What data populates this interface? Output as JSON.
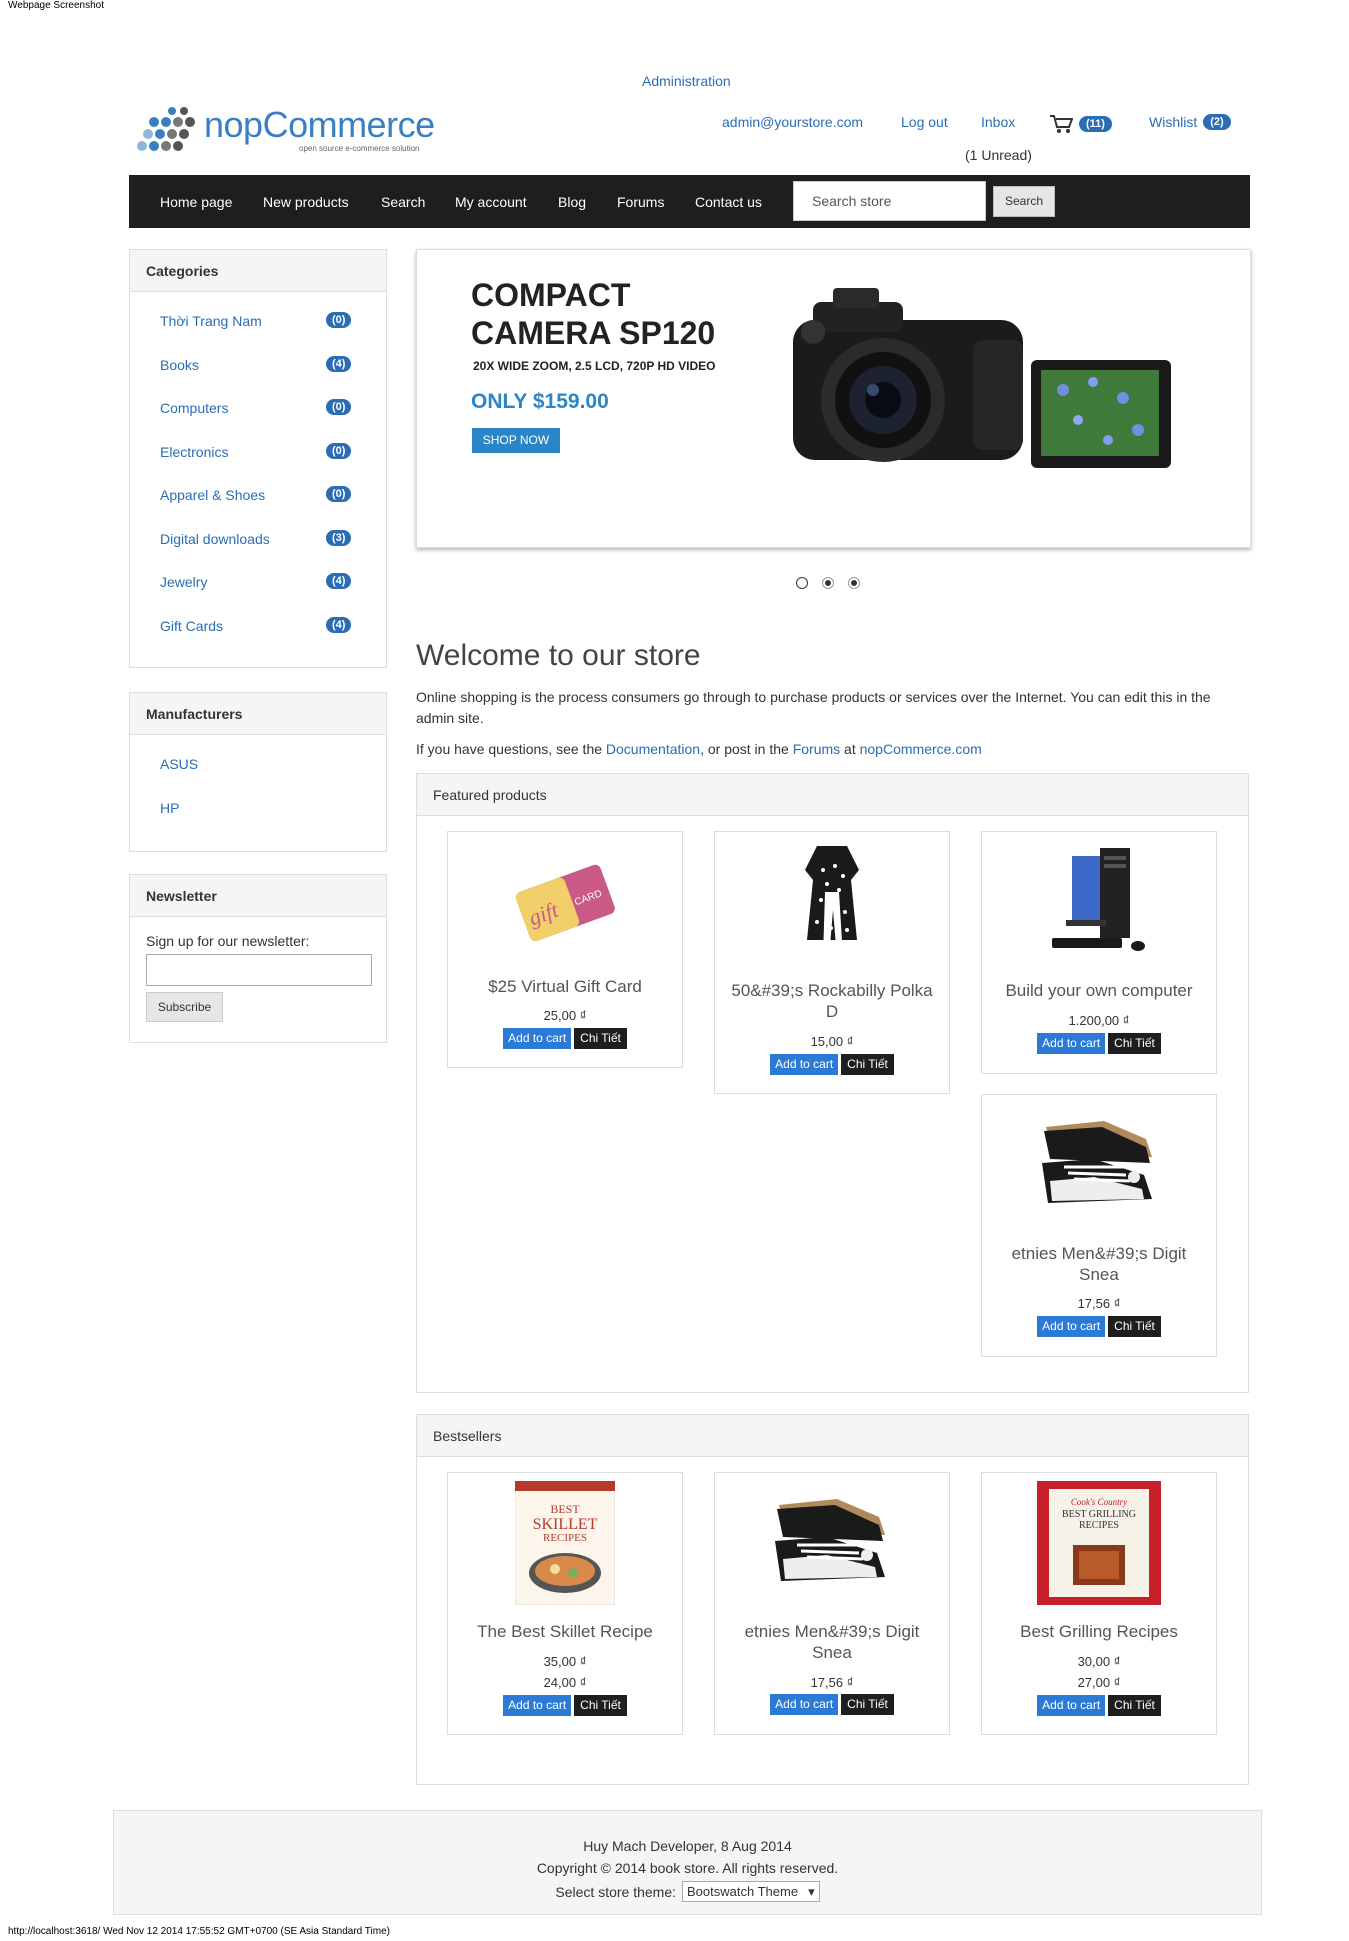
{
  "captions": {
    "top": "Webpage Screenshot",
    "bottom": "http://localhost:3618/ Wed Nov 12 2014 17:55:52 GMT+0700 (SE Asia Standard Time)"
  },
  "header": {
    "administration": "Administration",
    "logo_word": "nopCommerce",
    "logo_tagline": "open source e-commerce solution",
    "account": "admin@yourstore.com",
    "logout": "Log out",
    "inbox": "Inbox",
    "unread": "(1 Unread)",
    "cart_count": "(11)",
    "wishlist": "Wishlist",
    "wishlist_count": "(2)"
  },
  "nav": {
    "items": [
      "Home page",
      "New products",
      "Search",
      "My account",
      "Blog",
      "Forums",
      "Contact us"
    ],
    "search_placeholder": "Search store",
    "search_button": "Search"
  },
  "categories": {
    "title": "Categories",
    "items": [
      {
        "label": "Thời Trang Nam",
        "count": "(0)"
      },
      {
        "label": "Books",
        "count": "(4)"
      },
      {
        "label": "Computers",
        "count": "(0)"
      },
      {
        "label": "Electronics",
        "count": "(0)"
      },
      {
        "label": "Apparel & Shoes",
        "count": "(0)"
      },
      {
        "label": "Digital downloads",
        "count": "(3)"
      },
      {
        "label": "Jewelry",
        "count": "(4)"
      },
      {
        "label": "Gift Cards",
        "count": "(4)"
      }
    ]
  },
  "manufacturers": {
    "title": "Manufacturers",
    "items": [
      "ASUS",
      "HP"
    ]
  },
  "newsletter": {
    "title": "Newsletter",
    "label": "Sign up for our newsletter:",
    "email_value": "",
    "button": "Subscribe"
  },
  "slider": {
    "title_line1": "COMPACT",
    "title_line2": "CAMERA SP120",
    "subtitle": "20X WIDE ZOOM, 2.5 LCD, 720P HD VIDEO",
    "price": "ONLY $159.00",
    "button": "SHOP NOW",
    "active_slide": 1,
    "slide_count": 3
  },
  "welcome": {
    "title": "Welcome to our store",
    "intro": "Online shopping is the process consumers go through to purchase products or services over the Internet. You can edit this in the admin site.",
    "help_prefix": "If you have questions, see the",
    "help_doc": "Documentation",
    "help_mid": ", or post in the",
    "help_forums": "Forums",
    "help_at": "at",
    "help_site": "nopCommerce.com"
  },
  "featured": {
    "title": "Featured products",
    "products": [
      {
        "name": "$25 Virtual Gift Card",
        "price": "25,00 ₫",
        "icon": "gift-card-image"
      },
      {
        "name": "50&#39;s Rockabilly Polka D",
        "price": "15,00 ₫",
        "icon": "polka-dress-image"
      },
      {
        "name": "Build your own computer",
        "price": "1.200,00 ₫",
        "icon": "computer-image"
      },
      {
        "name": "etnies Men&#39;s Digit Snea",
        "price": "17,56 ₫",
        "icon": "sneaker-image"
      }
    ]
  },
  "bestsellers": {
    "title": "Bestsellers",
    "products": [
      {
        "name": "The Best Skillet Recipe",
        "price": "35,00 ₫",
        "price2": "24,00 ₫",
        "icon": "skillet-book-image"
      },
      {
        "name": "etnies Men&#39;s Digit Snea",
        "price": "17,56 ₫",
        "icon": "sneaker-image"
      },
      {
        "name": "Best Grilling Recipes",
        "price": "30,00 ₫",
        "price2": "27,00 ₫",
        "icon": "grilling-book-image"
      }
    ]
  },
  "buttons": {
    "add_to_cart": "Add to cart",
    "details": "Chi Tiết"
  },
  "footer": {
    "line1": "Huy Mach Developer, 8 Aug 2014",
    "line2": "Copyright © 2014 book store. All rights reserved.",
    "theme_label": "Select store theme:",
    "theme_value": "Bootswatch Theme"
  },
  "colors": {
    "accent": "#2a6db5",
    "navbar": "#1e1e1e",
    "slider_accent": "#2a86c8"
  }
}
